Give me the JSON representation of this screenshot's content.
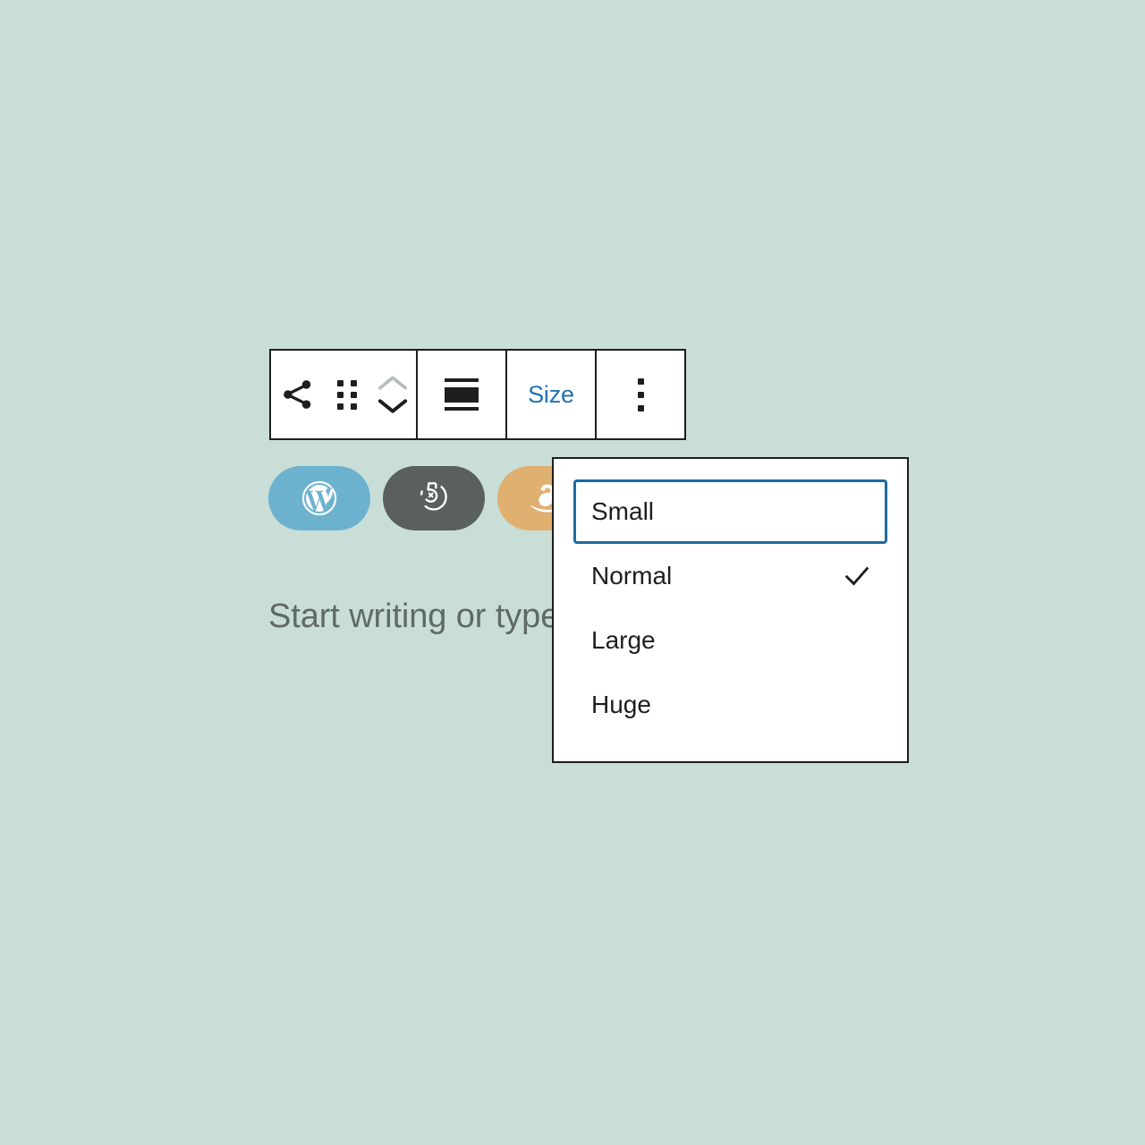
{
  "page": {
    "background_color": "#c9ded6",
    "app": "WordPress Block Editor"
  },
  "toolbar": {
    "groups": [
      {
        "name": "block-controls",
        "buttons": [
          {
            "name": "share-button",
            "icon": "share-icon",
            "label": "Share"
          },
          {
            "name": "drag-handle",
            "icon": "drag-handle-icon",
            "label": "Drag"
          },
          {
            "name": "block-movers",
            "icon": "move-up-down-icon",
            "label": "Move up or down"
          }
        ]
      },
      {
        "name": "alignment",
        "buttons": [
          {
            "name": "align-justify-button",
            "icon": "align-justify-icon",
            "label": "Align"
          }
        ]
      },
      {
        "name": "size",
        "buttons": [
          {
            "name": "size-button",
            "icon": "",
            "label": "Size"
          }
        ]
      },
      {
        "name": "more",
        "buttons": [
          {
            "name": "more-options-button",
            "icon": "kebab-menu-icon",
            "label": "Options"
          }
        ]
      }
    ],
    "size_label": "Size"
  },
  "social_links": {
    "items": [
      {
        "name": "social-link-wordpress",
        "service": "wordpress",
        "label": "WordPress",
        "color": "#6cb2cf"
      },
      {
        "name": "social-link-500px",
        "service": "fivehundredpx",
        "label": "500px",
        "color": "#59605f"
      },
      {
        "name": "social-link-amazon",
        "service": "amazon",
        "label": "Amazon",
        "color": "#e0b071"
      }
    ]
  },
  "editor": {
    "placeholder": "Start writing or type / to choose a block"
  },
  "size_menu": {
    "name": "size-dropdown",
    "items": [
      {
        "label": "Small",
        "checked": false,
        "focused": true
      },
      {
        "label": "Normal",
        "checked": true,
        "focused": false
      },
      {
        "label": "Large",
        "checked": false,
        "focused": false
      },
      {
        "label": "Huge",
        "checked": false,
        "focused": false
      }
    ],
    "focus_color": "#1d6aa0",
    "accent_color": "#2271b1"
  }
}
